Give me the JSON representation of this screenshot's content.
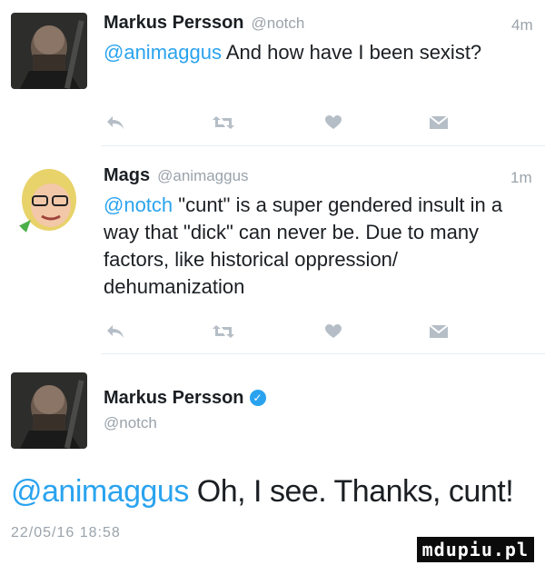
{
  "tweets": [
    {
      "name": "Markus Persson",
      "handle": "@notch",
      "time": "4m",
      "mention": "@animaggus",
      "text": " And how have I been sexist?"
    },
    {
      "name": "Mags",
      "handle": "@animaggus",
      "time": "1m",
      "mention": "@notch",
      "text": " \"cunt\" is a super gendered insult in a way that \"dick\" can never be. Due to many factors, like historical oppression/ dehumanization"
    }
  ],
  "detail": {
    "name": "Markus Persson",
    "handle": "@notch",
    "mention": "@animaggus",
    "text": " Oh, I see. Thanks, cunt!",
    "date": "22/05/16 18:58"
  },
  "actions": [
    "reply-icon",
    "retweet-icon",
    "like-icon",
    "dm-icon"
  ],
  "watermark": "mdupiu.pl",
  "colors": {
    "link": "#2aa3ef",
    "muted": "#9aa3ab",
    "icon": "#b5bec6"
  }
}
